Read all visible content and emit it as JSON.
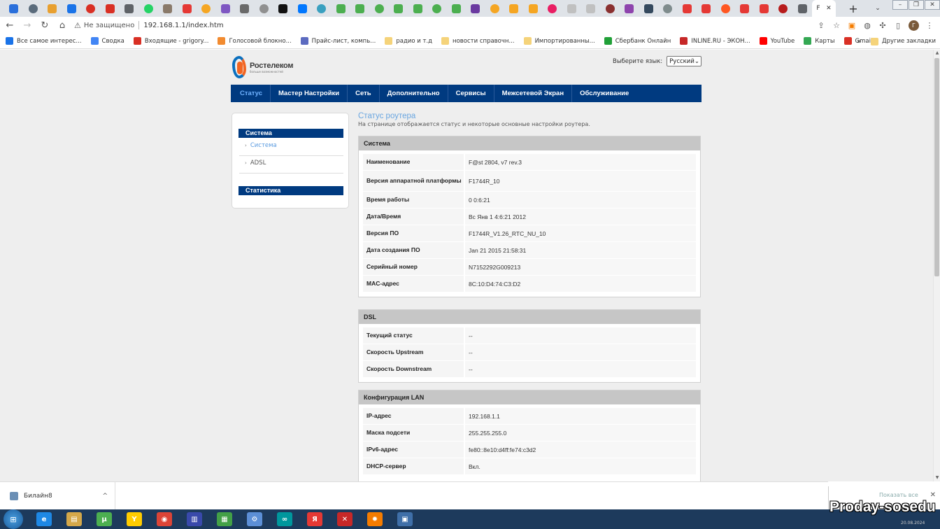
{
  "browser": {
    "tabs": [
      {
        "color": "#2a6fdb"
      },
      {
        "color": "#5a6b7c"
      },
      {
        "color": "#e8a030"
      },
      {
        "color": "#1a73e8"
      },
      {
        "color": "#d93025"
      },
      {
        "color": "#d93025"
      },
      {
        "color": "#5f6368"
      },
      {
        "color": "#25d366"
      },
      {
        "color": "#8a7a6a"
      },
      {
        "color": "#e53935"
      },
      {
        "color": "#f5a623"
      },
      {
        "color": "#7e57c2"
      },
      {
        "color": "#6a6a6a"
      },
      {
        "color": "#909090"
      },
      {
        "color": "#111111"
      },
      {
        "color": "#0077ff"
      },
      {
        "color": "#3aa0c0"
      },
      {
        "color": "#4caf50"
      },
      {
        "color": "#4caf50"
      },
      {
        "color": "#4caf50"
      },
      {
        "color": "#4caf50"
      },
      {
        "color": "#4caf50"
      },
      {
        "color": "#4caf50"
      },
      {
        "color": "#4caf50"
      },
      {
        "color": "#6a3aa0"
      },
      {
        "color": "#f5a623"
      },
      {
        "color": "#f5a623"
      },
      {
        "color": "#f5a623"
      },
      {
        "color": "#e91e63"
      },
      {
        "color": "#c0c0c0"
      },
      {
        "color": "#c0c0c0"
      },
      {
        "color": "#8a3030"
      },
      {
        "color": "#8e44ad"
      },
      {
        "color": "#34495e"
      },
      {
        "color": "#7f8c8d"
      },
      {
        "color": "#e53935"
      },
      {
        "color": "#e53935"
      },
      {
        "color": "#ff5722"
      },
      {
        "color": "#e53935"
      },
      {
        "color": "#e53935"
      },
      {
        "color": "#b71c1c"
      },
      {
        "color": "#5f6368"
      }
    ],
    "active_tab": {
      "label": "F",
      "close": "✕"
    },
    "new_tab": "+",
    "address": {
      "warning": "Не защищено",
      "url": "192.168.1.1/index.htm"
    },
    "bookmarks": [
      {
        "label": "Все самое интерес...",
        "color": "#1a73e8"
      },
      {
        "label": "Сводка",
        "color": "#4285f4"
      },
      {
        "label": "Входящие - grigory...",
        "color": "#d93025"
      },
      {
        "label": "Голосовой блокно...",
        "color": "#f28b30"
      },
      {
        "label": "Прайс-лист, компь...",
        "color": "#5c6bc0"
      },
      {
        "label": "радио и т.д",
        "color": "#f5d37a"
      },
      {
        "label": "новости справочн...",
        "color": "#f5d37a"
      },
      {
        "label": "Импортированны...",
        "color": "#f5d37a"
      },
      {
        "label": "Сбербанк Онлайн",
        "color": "#21a038"
      },
      {
        "label": "INLINE.RU - ЭКОН...",
        "color": "#c62828"
      },
      {
        "label": "YouTube",
        "color": "#ff0000"
      },
      {
        "label": "Карты",
        "color": "#34a853"
      },
      {
        "label": "Gmail",
        "color": "#d93025"
      }
    ],
    "other_bookmarks": "Другие закладки",
    "more_bookmarks": "»"
  },
  "router": {
    "brand": "Ростелеком",
    "slogan": "больше возможностей",
    "lang_label": "Выберите язык:",
    "lang_value": "Русский",
    "menu": [
      "Статус",
      "Мастер Настройки",
      "Сеть",
      "Дополнительно",
      "Сервисы",
      "Межсетевой Экран",
      "Обслуживание"
    ],
    "sidebar": {
      "section1": "Система",
      "items": [
        "Система",
        "ADSL"
      ],
      "section2": "Статистика"
    },
    "page_title": "Статус роутера",
    "page_desc": "На странице отображается статус и некоторые основные настройки роутера.",
    "sections": [
      {
        "title": "Система",
        "rows": [
          {
            "k": "Наименование",
            "v": "F@st 2804, v7 rev.3"
          },
          {
            "k": "Версия аппаратной платформы",
            "v": "F1744R_10"
          },
          {
            "k": "Время работы",
            "v": "0 0:6:21"
          },
          {
            "k": "Дата/Время",
            "v": "Вс Янв 1 4:6:21 2012"
          },
          {
            "k": "Версия ПО",
            "v": "F1744R_V1.26_RTC_NU_10"
          },
          {
            "k": "Дата создания ПО",
            "v": "Jan 21 2015 21:58:31"
          },
          {
            "k": "Серийный номер",
            "v": "N7152292G009213"
          },
          {
            "k": "MAC-адрес",
            "v": "8C:10:D4:74:C3:D2"
          }
        ]
      },
      {
        "title": "DSL",
        "rows": [
          {
            "k": "Текущий статус",
            "v": "--"
          },
          {
            "k": "Скорость Upstream",
            "v": "--"
          },
          {
            "k": "Скорость Downstream",
            "v": "--"
          }
        ]
      },
      {
        "title": "Конфигурация LAN",
        "rows": [
          {
            "k": "IP-адрес",
            "v": "192.168.1.1"
          },
          {
            "k": "Маска подсети",
            "v": "255.255.255.0"
          },
          {
            "k": "IPv6-адрес",
            "v": "fe80::8e10:d4ff:fe74:c3d2"
          },
          {
            "k": "DHCP-сервер",
            "v": "Вкл."
          }
        ]
      }
    ]
  },
  "download": {
    "name": "Билайн8",
    "caret": "^"
  },
  "notification": {
    "show_all": "Показать все",
    "close": "✕"
  },
  "taskbar": {
    "apps": [
      {
        "color": "#1e88e5",
        "glyph": "e"
      },
      {
        "color": "#d4a84a",
        "glyph": "▤"
      },
      {
        "color": "#4caf50",
        "glyph": "µ"
      },
      {
        "color": "#ffcc00",
        "glyph": "Y"
      },
      {
        "color": "#db4437",
        "glyph": "◉"
      },
      {
        "color": "#3949ab",
        "glyph": "▥"
      },
      {
        "color": "#43a047",
        "glyph": "▦"
      },
      {
        "color": "#5c8fd6",
        "glyph": "⚙"
      },
      {
        "color": "#00979d",
        "glyph": "∞"
      },
      {
        "color": "#e53935",
        "glyph": "Я"
      },
      {
        "color": "#c62828",
        "glyph": "✕"
      },
      {
        "color": "#f57c00",
        "glyph": "✹"
      },
      {
        "color": "#3f6fa8",
        "glyph": "▣"
      }
    ],
    "date": "20.08.2024"
  },
  "watermark": "Proday-sosedu"
}
